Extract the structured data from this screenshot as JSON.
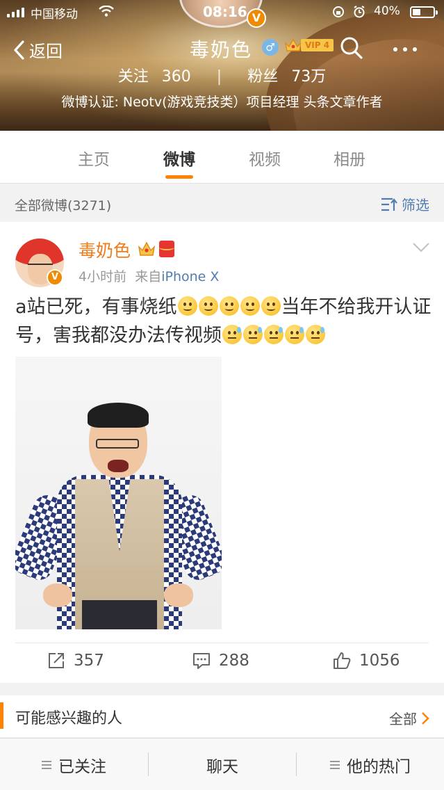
{
  "status_bar": {
    "carrier": "中国移动",
    "time": "08:16",
    "battery_pct": "40%",
    "battery_level": 0.4
  },
  "header": {
    "back_label": "返回",
    "username": "毒奶色",
    "vip_label": "VIP 4",
    "following_label": "关注",
    "following_count": "360",
    "fans_label": "粉丝",
    "fans_count": "73万",
    "verification": "微博认证: Neotv(游戏竞技类）项目经理 头条文章作者",
    "verified_badge": "V"
  },
  "tabs": [
    {
      "label": "主页",
      "active": false
    },
    {
      "label": "微博",
      "active": true
    },
    {
      "label": "视频",
      "active": false
    },
    {
      "label": "相册",
      "active": false
    }
  ],
  "filter_bar": {
    "count_label": "全部微博(3271)",
    "filter_label": "筛选"
  },
  "post": {
    "author": "毒奶色",
    "time": "4小时前",
    "source_prefix": "来自",
    "source": "iPhone X",
    "text_part1": "a站已死，有事烧纸",
    "text_part2": "当年不给我开认证号，害我都没办法传视频",
    "badge": "V",
    "emoji_smile_count": 5,
    "emoji_sweat_count": 5,
    "repost_count": "357",
    "comment_count": "288",
    "like_count": "1056"
  },
  "suggestion": {
    "title": "可能感兴趣的人",
    "all_label": "全部"
  },
  "toolbar": {
    "followed_label": "已关注",
    "chat_label": "聊天",
    "hot_label": "他的热门"
  },
  "colors": {
    "accent_orange": "#ff8200",
    "link_blue": "#507daf",
    "username_orange": "#f07b1a"
  }
}
